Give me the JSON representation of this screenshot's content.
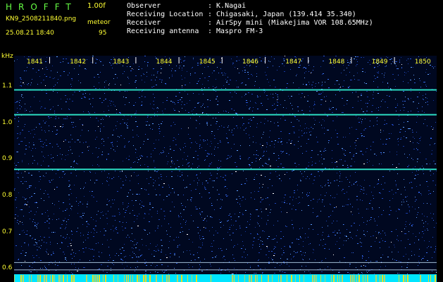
{
  "header": {
    "app_title": "HROFFT",
    "version": "1.00f",
    "filename": "KN9_2508211840.png",
    "meteor_label": "meteor",
    "datetime": "25.08.21 18:40",
    "meteor_count": "95"
  },
  "info": [
    {
      "label": "Observer",
      "value": ": K.Nagai"
    },
    {
      "label": "Receiving Location",
      "value": ": Chigasaki, Japan (139.414 35.340)"
    },
    {
      "label": "Receiver",
      "value": ": AirSpy mini (Miakejima VOR 108.65MHz)"
    },
    {
      "label": "Receiving antenna",
      "value": ": Maspro FM-3"
    }
  ],
  "spectrogram": {
    "unit": "kHz",
    "y_ticks": [
      "1.1",
      "1.0",
      "0.9",
      "0.8",
      "0.7",
      "0.6"
    ],
    "y_tick_values": [
      1.1,
      1.0,
      0.9,
      0.8,
      0.7,
      0.6
    ],
    "time_labels": [
      "1841",
      "1842",
      "1843",
      "1844",
      "1845",
      "1846",
      "1847",
      "1848",
      "1849",
      "1850"
    ],
    "y_range": [
      0.585,
      1.185
    ],
    "carrier_lines_khz": [
      1.093,
      1.025,
      0.875
    ],
    "faint_lines_khz": [
      0.618,
      0.598
    ],
    "colors": {
      "noise": "#1a3fae",
      "signal": "#33ffdd",
      "floor": "#00e5ff",
      "label": "#ffff33"
    }
  }
}
